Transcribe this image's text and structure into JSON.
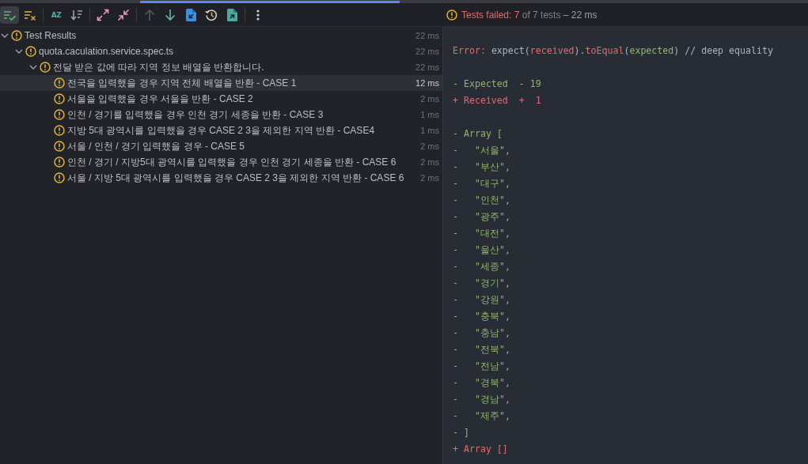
{
  "toolbar": {
    "groups": [
      [
        {
          "kind": "show-passed",
          "on": true,
          "disabled": false
        },
        {
          "kind": "show-ignored",
          "on": false,
          "disabled": false
        }
      ],
      [
        {
          "kind": "sort-alpha",
          "text": "AZ",
          "on": false,
          "disabled": false
        },
        {
          "kind": "sort-duration",
          "on": false,
          "disabled": false
        }
      ],
      [
        {
          "kind": "expand-all",
          "on": false,
          "disabled": false
        },
        {
          "kind": "collapse-all",
          "on": false,
          "disabled": false
        }
      ],
      [
        {
          "kind": "previous",
          "on": false,
          "disabled": true
        },
        {
          "kind": "next",
          "on": false,
          "disabled": false
        },
        {
          "kind": "import",
          "on": false,
          "disabled": false
        },
        {
          "kind": "history",
          "on": false,
          "disabled": false
        },
        {
          "kind": "export",
          "on": false,
          "disabled": false
        }
      ],
      [
        {
          "kind": "more",
          "on": false,
          "disabled": false
        }
      ]
    ]
  },
  "summary": {
    "failed": "Tests failed: 7",
    "total": "of 7 tests",
    "duration": "– 22 ms"
  },
  "tree": {
    "label": "Test Results",
    "time": "22 ms",
    "expanded": true,
    "selected": false,
    "children": [
      {
        "label": "quota.caculation.service.spec.ts",
        "time": "22 ms",
        "expanded": true,
        "selected": false,
        "children": [
          {
            "label": "전달 받은 값에 따라 지역 정보 배열을 반환합니다.",
            "time": "22 ms",
            "expanded": true,
            "selected": false,
            "children": [
              {
                "label": "전국을 입력했을 경우 지역 전체 배열을 반환 - CASE 1",
                "time": "12 ms",
                "selected": true
              },
              {
                "label": "서울을 입력했을 경우 서울을 반환 - CASE 2",
                "time": "2 ms",
                "selected": false
              },
              {
                "label": "인천 / 경기를 입력했을 경우 인천 경기 세종을 반환 - CASE 3",
                "time": "1 ms",
                "selected": false
              },
              {
                "label": "지방 5대 광역시를 입력했을 경우 CASE 2 3을 제외한 지역 반환 - CASE4",
                "time": "1 ms",
                "selected": false
              },
              {
                "label": "서울 / 인천 / 경기 입력했을 경우 - CASE 5",
                "time": "2 ms",
                "selected": false
              },
              {
                "label": "인천 / 경기 / 지방5대 광역시를 입력했을 경우 인천 경기 세종을 반환 - CASE 6",
                "time": "2 ms",
                "selected": false
              },
              {
                "label": "서울 / 지방 5대 광역시를 입력했을 경우 CASE 2 3을 제외한 지역 반환 - CASE 6",
                "time": "2 ms",
                "selected": false
              }
            ]
          }
        ]
      }
    ]
  },
  "console": {
    "blocks": [
      {
        "lines": [
          {
            "segments": [
              {
                "text": "Error: ",
                "kind": "received"
              },
              {
                "text": "expect(",
                "kind": "plain"
              },
              {
                "text": "received",
                "kind": "received"
              },
              {
                "text": ").",
                "kind": "plain"
              },
              {
                "text": "toEqual",
                "kind": "received"
              },
              {
                "text": "(",
                "kind": "plain"
              },
              {
                "text": "expected",
                "kind": "expected"
              },
              {
                "text": ") // deep equality",
                "kind": "plain"
              }
            ]
          }
        ]
      },
      {
        "lines": [
          {
            "segments": [
              {
                "text": "- Expected  - 19",
                "kind": "expected"
              }
            ]
          },
          {
            "segments": [
              {
                "text": "+ Received  +  1",
                "kind": "received"
              }
            ]
          }
        ]
      },
      {
        "lines": [
          {
            "segments": [
              {
                "text": "- Array [",
                "kind": "expected"
              }
            ]
          },
          {
            "segments": [
              {
                "text": "-   \"서울\",",
                "kind": "expected"
              }
            ]
          },
          {
            "segments": [
              {
                "text": "-   \"부산\",",
                "kind": "expected"
              }
            ]
          },
          {
            "segments": [
              {
                "text": "-   \"대구\",",
                "kind": "expected"
              }
            ]
          },
          {
            "segments": [
              {
                "text": "-   \"인천\",",
                "kind": "expected"
              }
            ]
          },
          {
            "segments": [
              {
                "text": "-   \"광주\",",
                "kind": "expected"
              }
            ]
          },
          {
            "segments": [
              {
                "text": "-   \"대전\",",
                "kind": "expected"
              }
            ]
          },
          {
            "segments": [
              {
                "text": "-   \"울산\",",
                "kind": "expected"
              }
            ]
          },
          {
            "segments": [
              {
                "text": "-   \"세종\",",
                "kind": "expected"
              }
            ]
          },
          {
            "segments": [
              {
                "text": "-   \"경기\",",
                "kind": "expected"
              }
            ]
          },
          {
            "segments": [
              {
                "text": "-   \"강원\",",
                "kind": "expected"
              }
            ]
          },
          {
            "segments": [
              {
                "text": "-   \"충북\",",
                "kind": "expected"
              }
            ]
          },
          {
            "segments": [
              {
                "text": "-   \"충남\",",
                "kind": "expected"
              }
            ]
          },
          {
            "segments": [
              {
                "text": "-   \"전북\",",
                "kind": "expected"
              }
            ]
          },
          {
            "segments": [
              {
                "text": "-   \"전남\",",
                "kind": "expected"
              }
            ]
          },
          {
            "segments": [
              {
                "text": "-   \"경북\",",
                "kind": "expected"
              }
            ]
          },
          {
            "segments": [
              {
                "text": "-   \"경남\",",
                "kind": "expected"
              }
            ]
          },
          {
            "segments": [
              {
                "text": "-   \"제주\",",
                "kind": "expected"
              }
            ]
          },
          {
            "segments": [
              {
                "text": "- ]",
                "kind": "expected"
              }
            ]
          },
          {
            "segments": [
              {
                "text": "+ Array []",
                "kind": "received"
              }
            ]
          }
        ]
      }
    ]
  }
}
